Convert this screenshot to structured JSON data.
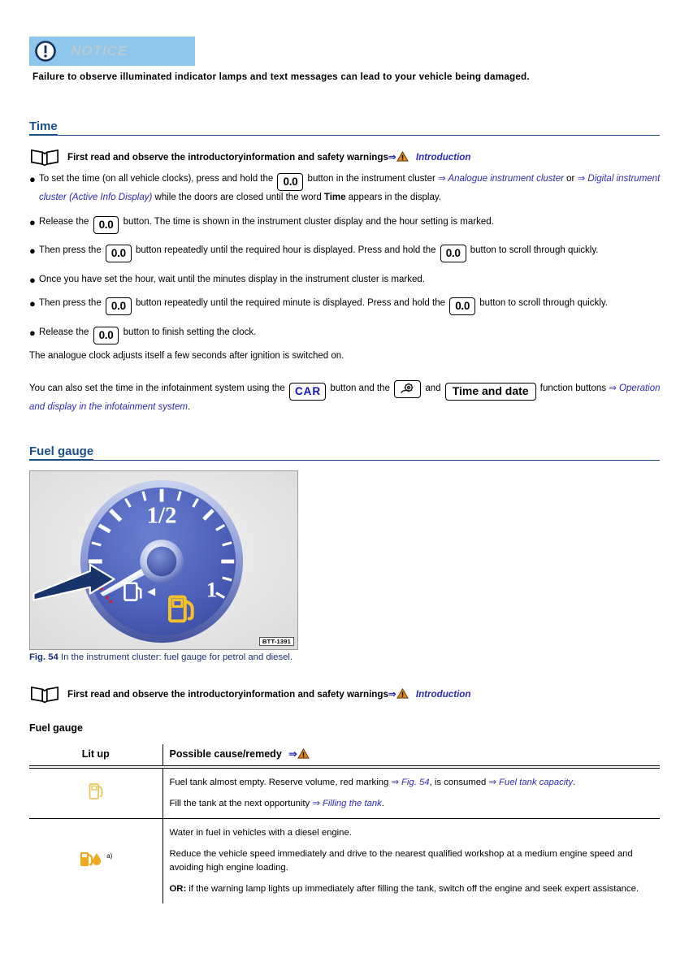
{
  "notice": {
    "icon": "exclamation-circle-icon",
    "label": "NOTICE",
    "band_color": "#8ec6ec",
    "text": "Failure to observe illuminated indicator lamps and text messages can lead to your vehicle being damaged."
  },
  "time_section": {
    "heading": "Time",
    "intro": {
      "icon": "open-book-icon",
      "text": "First read and observe the introductoryinformation and safety warnings",
      "arrow": "⇒",
      "warning_icon": "warning-triangle-icon",
      "link": "Introduction"
    },
    "bullets": [
      {
        "parts": [
          {
            "t": "text",
            "v": "To set the time (on all vehicle clocks), press and hold the "
          },
          {
            "t": "key",
            "v": "0.0"
          },
          {
            "t": "text",
            "v": " button in the instrument cluster "
          },
          {
            "t": "arrow",
            "v": "⇒"
          },
          {
            "t": "xref",
            "v": " Analogue instrument cluster"
          },
          {
            "t": "text",
            "v": " or "
          },
          {
            "t": "arrow",
            "v": "⇒"
          },
          {
            "t": "xref",
            "v": " Digital instrument cluster (Active Info Display)"
          },
          {
            "t": "text",
            "v": " while the doors are closed until the word "
          },
          {
            "t": "bold",
            "v": "Time"
          },
          {
            "t": "text",
            "v": " appears in the display."
          }
        ]
      },
      {
        "parts": [
          {
            "t": "text",
            "v": "Release the "
          },
          {
            "t": "key",
            "v": "0.0"
          },
          {
            "t": "text",
            "v": " button. The time is shown in the instrument cluster display and the hour setting is marked."
          }
        ]
      },
      {
        "parts": [
          {
            "t": "text",
            "v": "Then press the "
          },
          {
            "t": "key",
            "v": "0.0"
          },
          {
            "t": "text",
            "v": " button repeatedly until the required hour is displayed. Press and hold the "
          },
          {
            "t": "key",
            "v": "0.0"
          },
          {
            "t": "text",
            "v": " button to scroll through quickly."
          }
        ]
      },
      {
        "parts": [
          {
            "t": "text",
            "v": "Once you have set the hour, wait until the minutes display in the instrument cluster is marked."
          }
        ]
      },
      {
        "parts": [
          {
            "t": "text",
            "v": "Then press the "
          },
          {
            "t": "key",
            "v": "0.0"
          },
          {
            "t": "text",
            "v": " button repeatedly until the required minute is displayed. Press and hold the "
          },
          {
            "t": "key",
            "v": "0.0"
          },
          {
            "t": "text",
            "v": " button to scroll through quickly."
          }
        ]
      },
      {
        "parts": [
          {
            "t": "text",
            "v": "Release the "
          },
          {
            "t": "key",
            "v": "0.0"
          },
          {
            "t": "text",
            "v": " button to finish setting the clock."
          }
        ]
      }
    ],
    "para_clock": "The analogue clock adjusts itself a few seconds after ignition is switched on.",
    "para_infotainment": [
      {
        "t": "text",
        "v": "You can also set the time in the infotainment system using the "
      },
      {
        "t": "key-car",
        "v": "CAR"
      },
      {
        "t": "text",
        "v": " button and the "
      },
      {
        "t": "key-gear",
        "v": "setup-gear-icon"
      },
      {
        "t": "text",
        "v": " and "
      },
      {
        "t": "key-wide",
        "v": "Time and date"
      },
      {
        "t": "text",
        "v": " function buttons "
      },
      {
        "t": "arrow",
        "v": "⇒"
      },
      {
        "t": "xref",
        "v": " Operation and display in the infotainment system"
      },
      {
        "t": "text",
        "v": "."
      }
    ]
  },
  "fuel_section": {
    "heading": "Fuel gauge",
    "figure": {
      "name": "fuel-gauge-dial",
      "code": "BTT-1391",
      "dial_color": "#4a5fb5",
      "needle_color": "#ffffff",
      "reserve_color": "#cc2222",
      "pump_color": "#f2c230",
      "labels": {
        "half": "1/2",
        "full": "1"
      }
    },
    "caption_prefix": "Fig. 54",
    "caption": " In the instrument cluster: fuel gauge for petrol and diesel.",
    "intro": {
      "icon": "open-book-icon",
      "text": "First read and observe the introductoryinformation and safety warnings",
      "arrow": "⇒",
      "warning_icon": "warning-triangle-icon",
      "link": "Introduction"
    },
    "table": {
      "title": "Fuel gauge",
      "headers": {
        "col1": "Lit up",
        "col2": "Possible cause/remedy",
        "col2_arrow": "⇒",
        "col2_icon": "warning-triangle-icon"
      },
      "rows": [
        {
          "icon": "fuel-pump-outline-icon",
          "footnote": "",
          "paragraphs": [
            [
              {
                "t": "text",
                "v": "Fuel tank almost empty. Reserve volume, red marking "
              },
              {
                "t": "arrow",
                "v": "⇒"
              },
              {
                "t": "xref",
                "v": " Fig. 54"
              },
              {
                "t": "text",
                "v": ", is consumed "
              },
              {
                "t": "arrow",
                "v": "⇒"
              },
              {
                "t": "xref",
                "v": " Fuel tank capacity"
              },
              {
                "t": "text",
                "v": "."
              }
            ],
            [
              {
                "t": "text",
                "v": "Fill the tank at the next opportunity "
              },
              {
                "t": "arrow",
                "v": "⇒"
              },
              {
                "t": "xref",
                "v": " Filling the tank"
              },
              {
                "t": "text",
                "v": "."
              }
            ]
          ]
        },
        {
          "icon": "fuel-pump-water-icon",
          "footnote": "a)",
          "paragraphs": [
            [
              {
                "t": "text",
                "v": "Water in fuel in vehicles with a diesel engine."
              }
            ],
            [
              {
                "t": "text",
                "v": "Reduce the vehicle speed immediately and drive to the nearest qualified workshop at a medium engine speed and avoiding high engine loading."
              }
            ],
            [
              {
                "t": "bold",
                "v": "OR:"
              },
              {
                "t": "text",
                "v": " if the warning lamp lights up immediately after filling the tank, switch off the engine and seek expert assistance."
              }
            ]
          ]
        }
      ]
    }
  },
  "colors": {
    "heading_blue": "#1a4f8a",
    "xref_blue": "#2b2bbb",
    "caption_blue": "#1a2f7a",
    "notice_blue": "#8ec6ec",
    "warning_orange": "#e8881a"
  }
}
